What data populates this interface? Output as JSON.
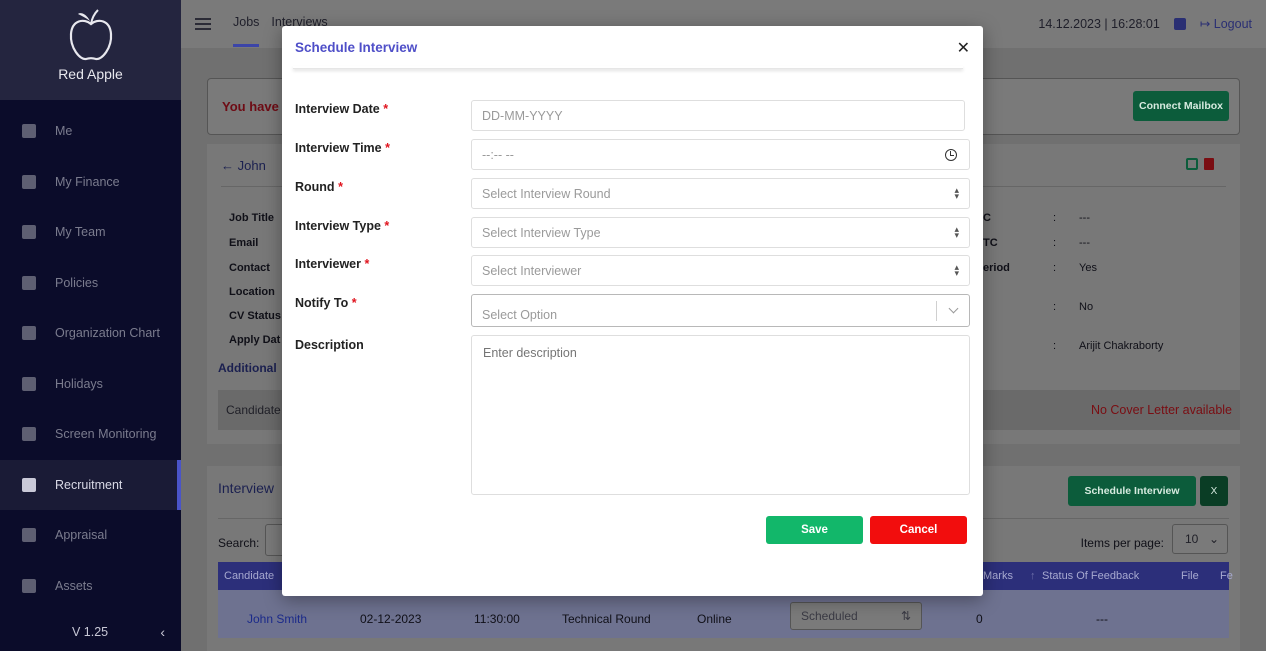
{
  "app": {
    "brand": "Red Apple",
    "version": "V 1.25"
  },
  "sidebar": {
    "items": [
      {
        "label": "Me",
        "icon": "user-icon"
      },
      {
        "label": "My Finance",
        "icon": "hand-coin-icon"
      },
      {
        "label": "My Team",
        "icon": "users-icon"
      },
      {
        "label": "Policies",
        "icon": "file-icon"
      },
      {
        "label": "Organization Chart",
        "icon": "sitemap-icon"
      },
      {
        "label": "Holidays",
        "icon": "calendar-icon"
      },
      {
        "label": "Screen Monitoring",
        "icon": "laptop-icon"
      },
      {
        "label": "Recruitment",
        "icon": "envelope-icon",
        "active": true
      },
      {
        "label": "Appraisal",
        "icon": "shield-icon"
      },
      {
        "label": "Assets",
        "icon": "laptop-icon"
      }
    ]
  },
  "topbar": {
    "tabs": [
      "Jobs",
      "Interviews"
    ],
    "datetime": "14.12.2023 | 16:28:01",
    "logout": "Logout"
  },
  "background": {
    "alert_text": "You have",
    "connect_mailbox": "Connect Mailbox",
    "candidate_name": "John",
    "left_labels": [
      "Job Title",
      "Email",
      "Contact",
      "Location",
      "CV Status",
      "Apply Dat"
    ],
    "right_labels": [
      "C",
      "TC",
      "eriod",
      "",
      ""
    ],
    "right_values": [
      "---",
      "---",
      "Yes",
      "No",
      "Arijit Chakraborty"
    ],
    "additional": "Additional",
    "candidate_label": "Candidate",
    "no_cover_letter": "No Cover Letter available",
    "interviews_title": "Interview",
    "schedule_interview_btn": "Schedule Interview",
    "search_label": "Search:",
    "items_per_page_label": "Items per page:",
    "items_per_page_value": "10",
    "table_headers": [
      "Candidate",
      "Marks",
      "Status Of Feedback",
      "File",
      "Fe"
    ],
    "row": {
      "candidate": "John Smith",
      "date": "02-12-2023",
      "time": "11:30:00",
      "round": "Technical Round",
      "type": "Online",
      "status": "Scheduled",
      "marks": "0",
      "feedback": "---"
    }
  },
  "modal": {
    "title": "Schedule Interview",
    "fields": {
      "interview_date": {
        "label": "Interview Date",
        "placeholder": "DD-MM-YYYY"
      },
      "interview_time": {
        "label": "Interview Time",
        "placeholder": "--:-- --"
      },
      "round": {
        "label": "Round",
        "placeholder": "Select Interview Round"
      },
      "interview_type": {
        "label": "Interview Type",
        "placeholder": "Select Interview Type"
      },
      "interviewer": {
        "label": "Interviewer",
        "placeholder": "Select Interviewer"
      },
      "notify_to": {
        "label": "Notify To",
        "placeholder": "Select Option"
      },
      "description": {
        "label": "Description",
        "placeholder": "Enter description"
      }
    },
    "required_mark": "*",
    "save": "Save",
    "cancel": "Cancel"
  },
  "colors": {
    "modal_title": "#4f4fc8",
    "save": "#12b76a",
    "cancel": "#f20d0d",
    "required": "#e0141e",
    "sidebar": "#0b0c2a"
  }
}
